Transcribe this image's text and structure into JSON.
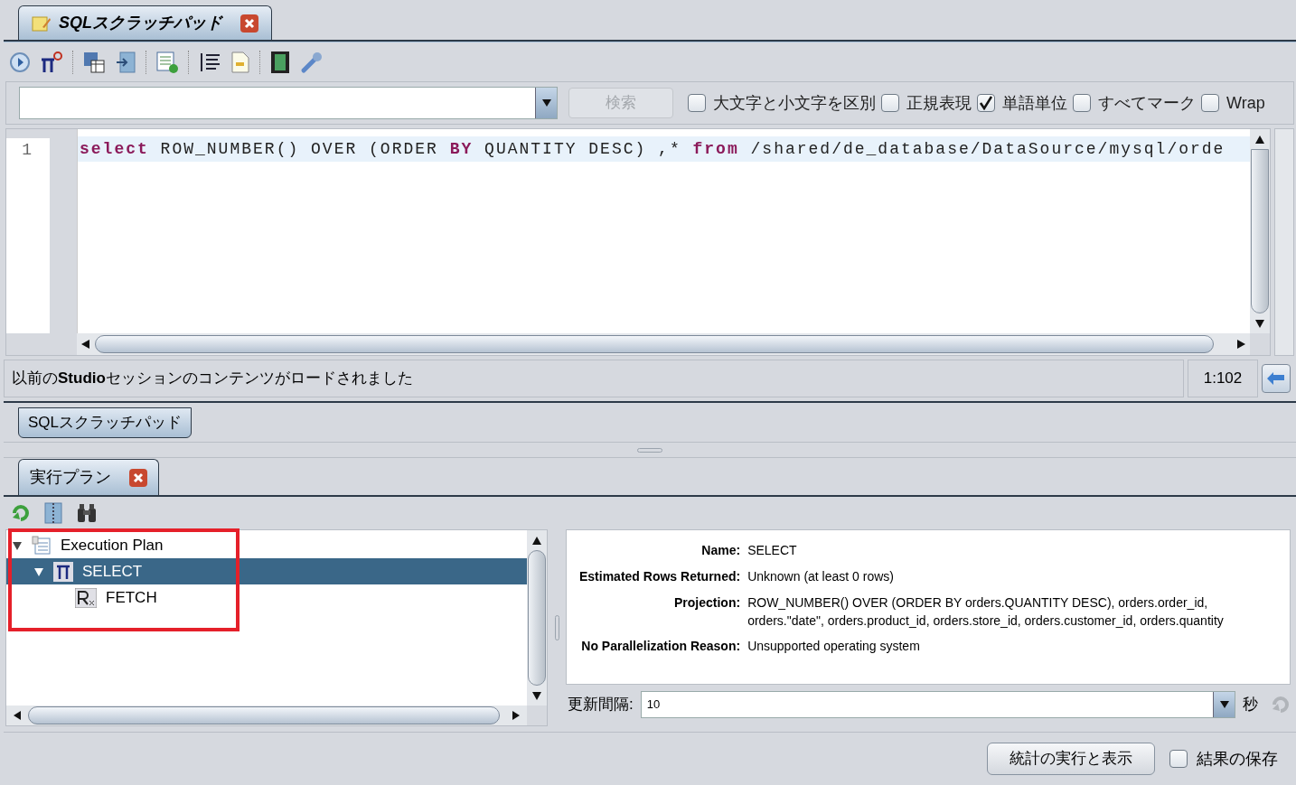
{
  "editor_tab": {
    "title": "SQLスクラッチパッド",
    "selected": true
  },
  "search": {
    "button": "検索",
    "button_disabled": true,
    "options": [
      {
        "label": "大文字と小文字を区別",
        "checked": false
      },
      {
        "label": "正規表現",
        "checked": false
      },
      {
        "label": "単語単位",
        "checked": true
      },
      {
        "label": "すべてマーク",
        "checked": false
      },
      {
        "label": "Wrap",
        "checked": false
      }
    ]
  },
  "editor": {
    "lines": [
      {
        "number": "1",
        "tokens": [
          {
            "kind": "keyword",
            "text": "select"
          },
          {
            "kind": "plain",
            "text": " ROW_NUMBER() OVER (ORDER "
          },
          {
            "kind": "keyword",
            "text": "BY"
          },
          {
            "kind": "plain",
            "text": " QUANTITY DESC) ,* "
          },
          {
            "kind": "keyword",
            "text": "from"
          },
          {
            "kind": "plain",
            "text": " /shared/de_database/DataSource/mysql/orde"
          }
        ]
      }
    ]
  },
  "status_bar": {
    "message": "以前の**Studio**セッションのコンテンツがロードされました",
    "position": "1:102"
  },
  "view_tabs": [
    {
      "label": "SQLスクラッチパッド",
      "selected": true
    }
  ],
  "plan_tab": {
    "title": "実行プラン"
  },
  "tree": [
    {
      "label": "Execution Plan",
      "expanded": true,
      "selected": false,
      "children": [
        {
          "label": "SELECT",
          "expanded": true,
          "selected": true,
          "children": [
            {
              "label": "FETCH",
              "selected": false
            }
          ]
        }
      ]
    }
  ],
  "details": [
    {
      "label": "Name:",
      "value": "SELECT"
    },
    {
      "label": "Estimated Rows Returned:",
      "value": "Unknown (at least 0 rows)"
    },
    {
      "label": "Projection:",
      "value": "ROW_NUMBER() OVER (ORDER BY orders.QUANTITY DESC), orders.order_id, orders.\"date\", orders.product_id, orders.store_id, orders.customer_id, orders.quantity"
    },
    {
      "label": "No Parallelization Reason:",
      "value": "Unsupported operating system"
    }
  ],
  "refresh": {
    "label": "更新間隔:",
    "value": "10",
    "unit": "秒"
  },
  "run_button": "統計の実行と表示",
  "save_results": {
    "label": "結果の保存",
    "checked": false
  }
}
